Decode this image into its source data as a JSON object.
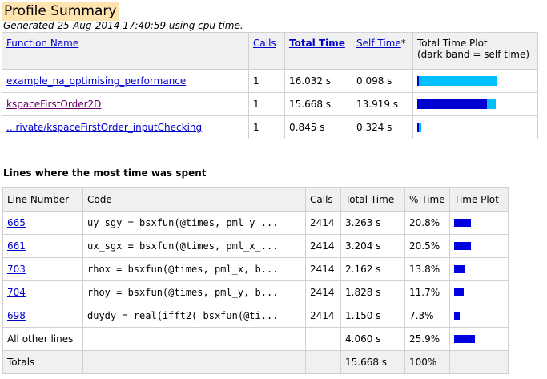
{
  "title": "Profile Summary",
  "generated": "Generated 25-Aug-2014 17:40:59 using cpu time.",
  "summary": {
    "headers": {
      "function_name": "Function Name",
      "calls": "Calls",
      "total_time": "Total Time",
      "self_time": "Self Time",
      "self_time_marker": "*",
      "plot_line1": "Total Time Plot",
      "plot_line2": "(dark band = self time)"
    },
    "rows": [
      {
        "name": "example_na_optimising_performance",
        "calls": "1",
        "total": "16.032 s",
        "self": "0.098 s",
        "total_frac": 1.0,
        "self_frac": 0.006
      },
      {
        "name": "kspaceFirstOrder2D",
        "calls": "1",
        "total": "15.668 s",
        "self": "13.919 s",
        "total_frac": 0.977,
        "self_frac": 0.868
      },
      {
        "name": "...rivate/kspaceFirstOrder_inputChecking",
        "calls": "1",
        "total": "0.845 s",
        "self": "0.324 s",
        "total_frac": 0.053,
        "self_frac": 0.02
      }
    ]
  },
  "lines_section": {
    "title": "Lines where the most time was spent",
    "headers": {
      "line": "Line Number",
      "code": "Code",
      "calls": "Calls",
      "total": "Total Time",
      "pct": "% Time",
      "plot": "Time Plot"
    },
    "rows": [
      {
        "line": "665",
        "code": "uy_sgy = bsxfun(@times, pml_y_...",
        "calls": "2414",
        "total": "3.263 s",
        "pct": "20.8%",
        "frac": 0.208
      },
      {
        "line": "661",
        "code": "ux_sgx = bsxfun(@times, pml_x_...",
        "calls": "2414",
        "total": "3.204 s",
        "pct": "20.5%",
        "frac": 0.205
      },
      {
        "line": "703",
        "code": "rhox = bsxfun(@times, pml_x, b...",
        "calls": "2414",
        "total": "2.162 s",
        "pct": "13.8%",
        "frac": 0.138
      },
      {
        "line": "704",
        "code": "rhoy = bsxfun(@times, pml_y, b...",
        "calls": "2414",
        "total": "1.828 s",
        "pct": "11.7%",
        "frac": 0.117
      },
      {
        "line": "698",
        "code": "duydy = real(ifft2( bsxfun(@ti...",
        "calls": "2414",
        "total": "1.150 s",
        "pct": "7.3%",
        "frac": 0.073
      }
    ],
    "other": {
      "label": "All other lines",
      "total": "4.060 s",
      "pct": "25.9%",
      "frac": 0.259
    },
    "totals": {
      "label": "Totals",
      "total": "15.668 s",
      "pct": "100%"
    }
  }
}
